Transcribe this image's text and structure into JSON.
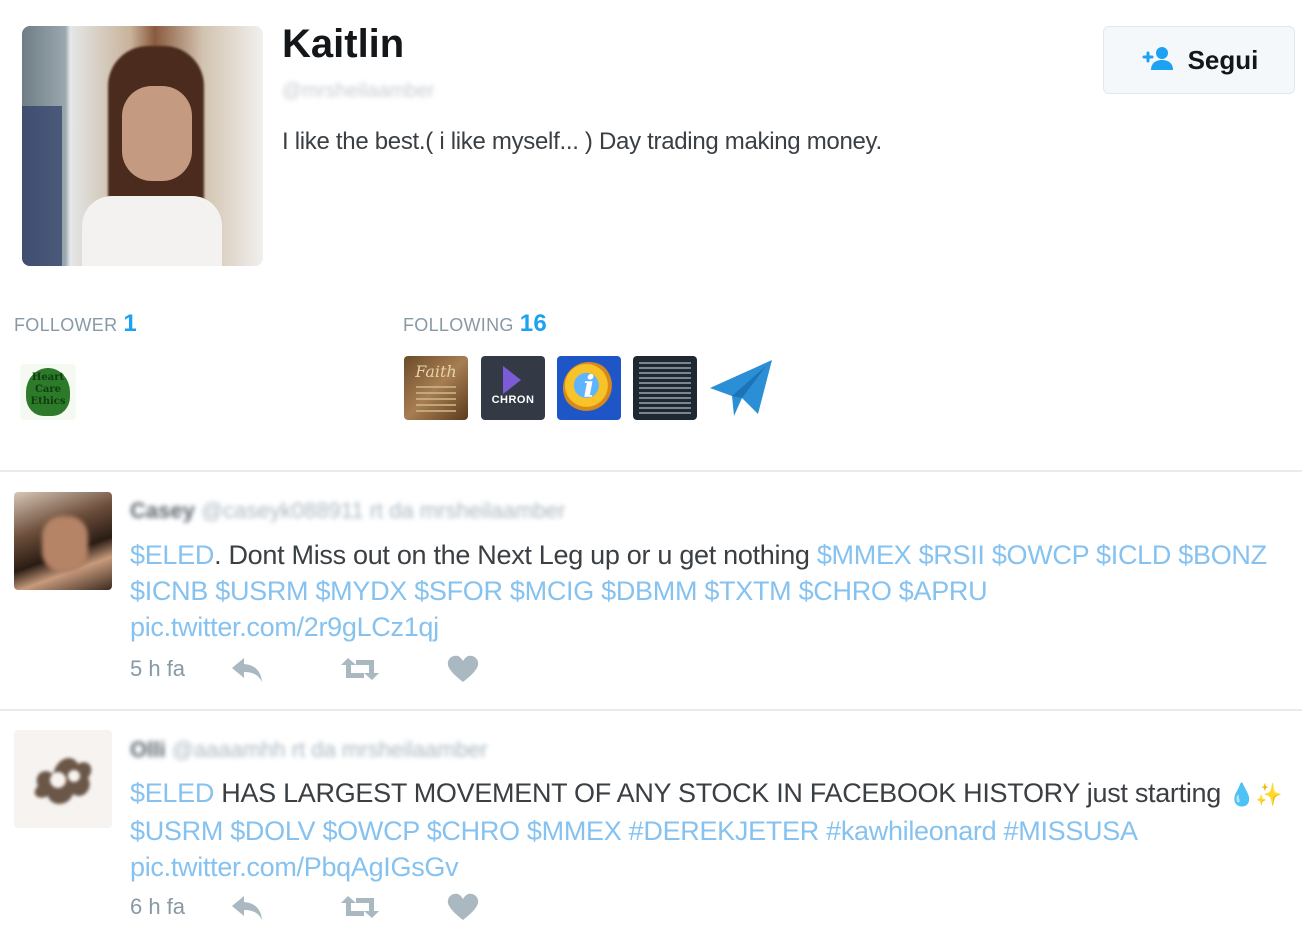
{
  "profile": {
    "name": "Kaitlin",
    "handle": "@mrsheilaamber",
    "bio": "I like the best.( i like myself... ) Day trading making money."
  },
  "follow_button": {
    "label": "Segui",
    "icon": "add-user-icon"
  },
  "stats": {
    "follower": {
      "label": "FOLLOWER",
      "count": "1",
      "thumbnails": [
        {
          "text": "Heart Care Ethics"
        }
      ]
    },
    "following": {
      "label": "FOLLOWING",
      "count": "16",
      "thumbnails": [
        {
          "text": "Faith"
        },
        {
          "text": "CHRON"
        },
        {
          "text": "i"
        },
        {
          "text": ""
        },
        {
          "icon": "paper-plane-icon"
        }
      ]
    }
  },
  "tweets": [
    {
      "author": "Casey",
      "handle": "@caseyk088911",
      "context": "rt da mrsheilaamber",
      "segments": [
        {
          "t": "$ELED",
          "k": "tok"
        },
        {
          "t": ". Dont Miss out on the Next Leg up or u get nothing ",
          "k": "txt"
        },
        {
          "t": "$MMEX",
          "k": "tok"
        },
        {
          "t": " ",
          "k": "txt"
        },
        {
          "t": "$RSII",
          "k": "tok"
        },
        {
          "t": " ",
          "k": "txt"
        },
        {
          "t": "$OWCP",
          "k": "tok"
        },
        {
          "t": " ",
          "k": "txt"
        },
        {
          "t": "$ICLD",
          "k": "tok"
        },
        {
          "t": " ",
          "k": "txt"
        },
        {
          "t": "$BONZ",
          "k": "tok"
        },
        {
          "t": " ",
          "k": "txt"
        },
        {
          "t": "$ICNB",
          "k": "tok"
        },
        {
          "t": " ",
          "k": "txt"
        },
        {
          "t": "$USRM",
          "k": "tok"
        },
        {
          "t": " ",
          "k": "txt"
        },
        {
          "t": "$MYDX",
          "k": "tok"
        },
        {
          "t": " ",
          "k": "txt"
        },
        {
          "t": "$SFOR",
          "k": "tok"
        },
        {
          "t": " ",
          "k": "txt"
        },
        {
          "t": "$MCIG",
          "k": "tok"
        },
        {
          "t": " ",
          "k": "txt"
        },
        {
          "t": "$DBMM",
          "k": "tok"
        },
        {
          "t": " ",
          "k": "txt"
        },
        {
          "t": "$TXTM",
          "k": "tok"
        },
        {
          "t": " ",
          "k": "txt"
        },
        {
          "t": "$CHRO",
          "k": "tok"
        },
        {
          "t": " ",
          "k": "txt"
        },
        {
          "t": "$APRU",
          "k": "tok"
        }
      ],
      "link": "pic.twitter.com/2r9gLCz1qj",
      "time": "5 h fa"
    },
    {
      "author": "Olli",
      "handle": "@aaaamhh",
      "context": "rt da mrsheilaamber",
      "segments": [
        {
          "t": "$ELED",
          "k": "tok"
        },
        {
          "t": " HAS LARGEST MOVEMENT OF ANY STOCK IN FACEBOOK HISTORY just starting ",
          "k": "txt"
        },
        {
          "t": "💧✨ ",
          "k": "emo"
        },
        {
          "t": "$USRM",
          "k": "tok"
        },
        {
          "t": " ",
          "k": "txt"
        },
        {
          "t": "$DOLV",
          "k": "tok"
        },
        {
          "t": " ",
          "k": "txt"
        },
        {
          "t": "$OWCP",
          "k": "tok"
        },
        {
          "t": " ",
          "k": "txt"
        },
        {
          "t": "$CHRO",
          "k": "tok"
        },
        {
          "t": " ",
          "k": "txt"
        },
        {
          "t": "$MMEX",
          "k": "tok"
        },
        {
          "t": " ",
          "k": "txt"
        },
        {
          "t": "#DEREKJETER",
          "k": "tok"
        },
        {
          "t": " ",
          "k": "txt"
        },
        {
          "t": "#kawhileonard",
          "k": "tok"
        },
        {
          "t": " ",
          "k": "txt"
        },
        {
          "t": "#MISSUSA",
          "k": "tok"
        }
      ],
      "link": "pic.twitter.com/PbqAgIGsGv",
      "time": "6 h fa"
    }
  ],
  "colors": {
    "accent": "#1da1f2",
    "link": "#86c2f0",
    "muted": "#8899a6"
  }
}
